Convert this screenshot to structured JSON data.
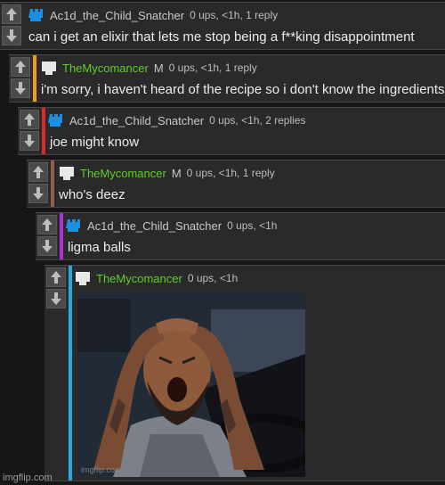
{
  "colors": {
    "comment_bg": "#2a2a2a",
    "blue_rail": "#2aa8df",
    "orange_rail": "#f29a1a",
    "red_rail": "#e0282b",
    "brown_rail": "#9a5b4b",
    "purple_rail": "#b02fd2",
    "mod_username": "#5fcf2a"
  },
  "icons": {
    "upvote": "arrow-up-icon",
    "downvote": "arrow-down-icon",
    "avatar_blue": "blue-pixel-avatar-icon",
    "avatar_white": "white-pixel-avatar-icon"
  },
  "comments": [
    {
      "username": "Ac1d_the_Child_Snatcher",
      "meta": "0 ups, <1h, 1 reply",
      "text": "can i get an elixir that lets me stop being a f**king disappointment"
    },
    {
      "username": "TheMycomancer",
      "mod_badge": "M",
      "meta": "0 ups, <1h, 1 reply",
      "text": "i'm sorry, i haven't heard of the recipe so i don't know the ingredients"
    },
    {
      "username": "Ac1d_the_Child_Snatcher",
      "meta": "0 ups, <1h, 2 replies",
      "text": "joe might know"
    },
    {
      "username": "TheMycomancer",
      "mod_badge": "M",
      "meta": "0 ups, <1h, 1 reply",
      "text": "who's deez"
    },
    {
      "username": "Ac1d_the_Child_Snatcher",
      "meta": "0 ups, <1h",
      "text": "ligma balls"
    },
    {
      "username": "TheMycomancer",
      "meta": "0 ups, <1h",
      "image_watermark": "imgflip.com"
    }
  ],
  "footer": "imgflip.com"
}
